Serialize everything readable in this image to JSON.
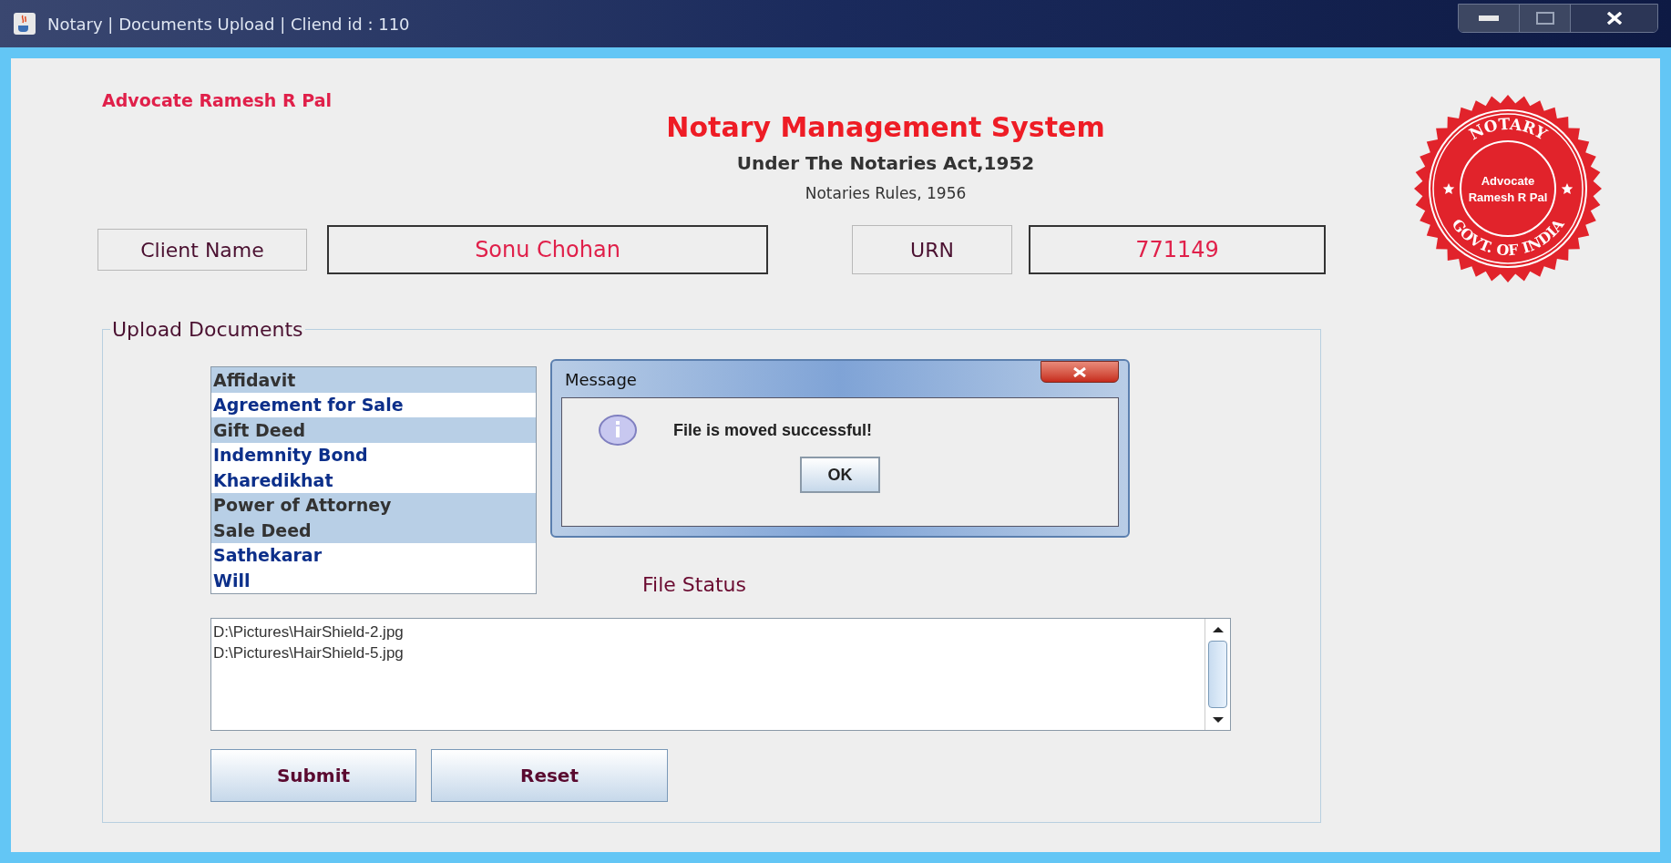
{
  "window": {
    "title": "Notary | Documents Upload | Cliend id : 110"
  },
  "header": {
    "advocate": "Advocate Ramesh R Pal",
    "title": "Notary Management System",
    "subtitle": "Under The Notaries Act,1952",
    "rules": "Notaries Rules, 1956"
  },
  "seal": {
    "top": "NOTARY",
    "line_1": "Advocate",
    "line_2": "Ramesh R Pal",
    "bottom": "GOVT. OF INDIA"
  },
  "client": {
    "name_label": "Client Name",
    "name_value": "Sonu Chohan",
    "urn_label": "URN",
    "urn_value": "771149"
  },
  "upload": {
    "title": "Upload Documents",
    "documents": [
      {
        "label": "Affidavit",
        "selected": true
      },
      {
        "label": "Agreement for Sale",
        "selected": false
      },
      {
        "label": "Gift Deed",
        "selected": true
      },
      {
        "label": "Indemnity Bond",
        "selected": false
      },
      {
        "label": "Kharedikhat",
        "selected": false
      },
      {
        "label": "Power of Attorney",
        "selected": true
      },
      {
        "label": "Sale Deed",
        "selected": true
      },
      {
        "label": "Sathekarar",
        "selected": false
      },
      {
        "label": "Will",
        "selected": false
      }
    ],
    "file_status_label": "File Status",
    "files": [
      "D:\\Pictures\\HairShield-2.jpg",
      "D:\\Pictures\\HairShield-5.jpg"
    ],
    "buttons": [
      "Submit",
      "Reset"
    ]
  },
  "dialog": {
    "title": "Message",
    "message": "File is moved successful!",
    "button": "OK"
  }
}
